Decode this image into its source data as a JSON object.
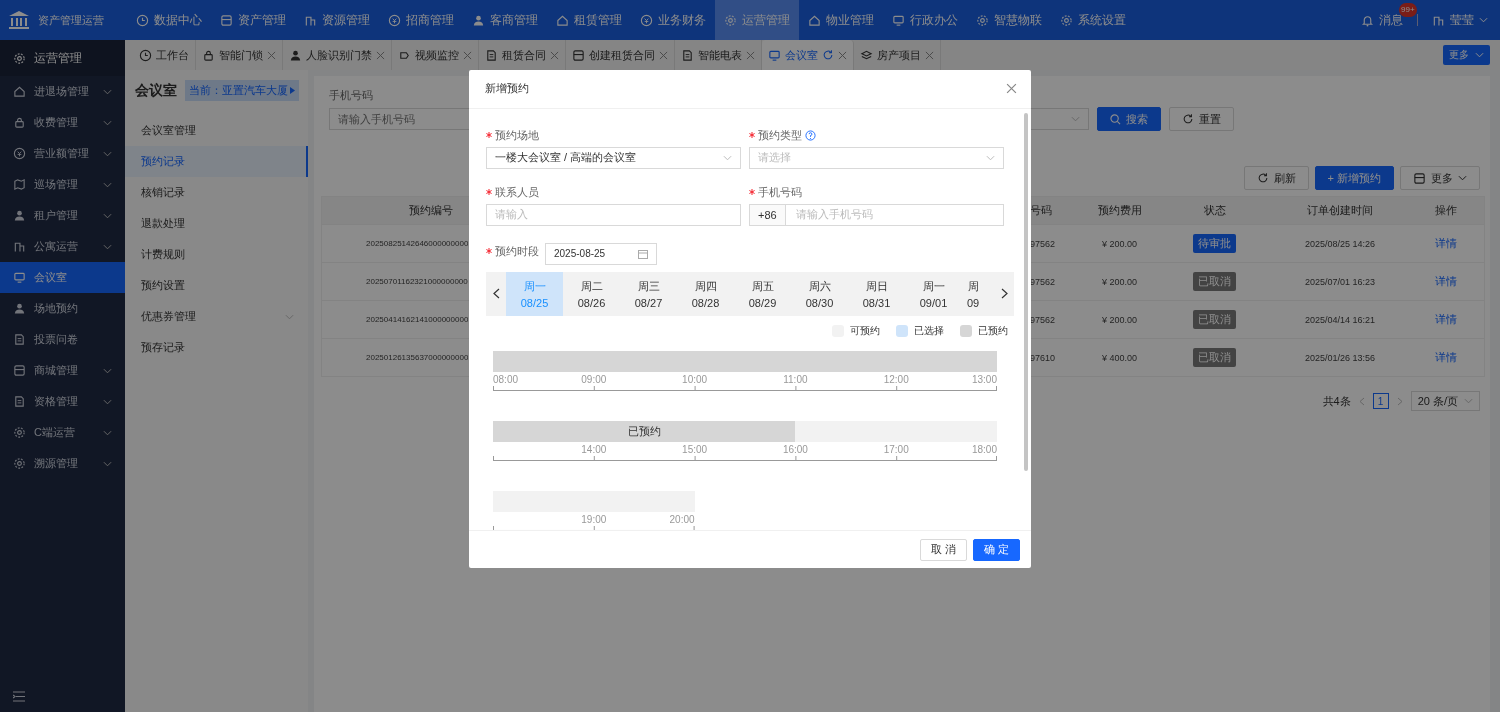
{
  "topbar": {
    "logo_text": "资产管理运营",
    "nav": [
      {
        "label": "数据中心",
        "selected": false
      },
      {
        "label": "资产管理",
        "selected": false
      },
      {
        "label": "资源管理",
        "selected": false
      },
      {
        "label": "招商管理",
        "selected": false
      },
      {
        "label": "客商管理",
        "selected": false
      },
      {
        "label": "租赁管理",
        "selected": false
      },
      {
        "label": "业务财务",
        "selected": false
      },
      {
        "label": "运营管理",
        "selected": true
      },
      {
        "label": "物业管理",
        "selected": false
      },
      {
        "label": "行政办公",
        "selected": false
      },
      {
        "label": "智慧物联",
        "selected": false
      },
      {
        "label": "系统设置",
        "selected": false
      }
    ],
    "messages": {
      "label": "消息",
      "badge": "99+"
    },
    "user": "莹莹"
  },
  "sidebar": {
    "title": "运营管理",
    "items": [
      {
        "label": "进退场管理",
        "expandable": true,
        "selected": false
      },
      {
        "label": "收费管理",
        "expandable": true,
        "selected": false
      },
      {
        "label": "营业额管理",
        "expandable": true,
        "selected": false
      },
      {
        "label": "巡场管理",
        "expandable": true,
        "selected": false
      },
      {
        "label": "租户管理",
        "expandable": true,
        "selected": false
      },
      {
        "label": "公寓运营",
        "expandable": true,
        "selected": false
      },
      {
        "label": "会议室",
        "expandable": false,
        "selected": true
      },
      {
        "label": "场地预约",
        "expandable": false,
        "selected": false
      },
      {
        "label": "投票问卷",
        "expandable": false,
        "selected": false
      },
      {
        "label": "商城管理",
        "expandable": true,
        "selected": false
      },
      {
        "label": "资格管理",
        "expandable": true,
        "selected": false
      },
      {
        "label": "C端运营",
        "expandable": true,
        "selected": false
      },
      {
        "label": "溯源管理",
        "expandable": true,
        "selected": false
      }
    ]
  },
  "tabs": [
    {
      "label": "工作台",
      "closable": false,
      "selected": false
    },
    {
      "label": "智能门锁",
      "closable": true,
      "selected": false
    },
    {
      "label": "人脸识别门禁",
      "closable": true,
      "selected": false
    },
    {
      "label": "视频监控",
      "closable": true,
      "selected": false
    },
    {
      "label": "租赁合同",
      "closable": true,
      "selected": false
    },
    {
      "label": "创建租赁合同",
      "closable": true,
      "selected": false
    },
    {
      "label": "智能电表",
      "closable": true,
      "selected": false
    },
    {
      "label": "会议室",
      "closable": true,
      "selected": true
    },
    {
      "label": "房产项目",
      "closable": true,
      "selected": false
    }
  ],
  "tabs_more": "更多",
  "submenu": {
    "title": "会议室",
    "current": "当前：亚置汽车大厦",
    "items": [
      {
        "label": "会议室管理",
        "expandable": false,
        "selected": false
      },
      {
        "label": "预约记录",
        "expandable": false,
        "selected": true
      },
      {
        "label": "核销记录",
        "expandable": false,
        "selected": false
      },
      {
        "label": "退款处理",
        "expandable": false,
        "selected": false
      },
      {
        "label": "计费规则",
        "expandable": false,
        "selected": false
      },
      {
        "label": "预约设置",
        "expandable": false,
        "selected": false
      },
      {
        "label": "优惠券管理",
        "expandable": true,
        "selected": false
      },
      {
        "label": "预存记录",
        "expandable": false,
        "selected": false
      }
    ]
  },
  "filter": {
    "label": "手机号码",
    "placeholder": "请输入手机号码",
    "search": "搜索",
    "reset": "重置"
  },
  "toolbar": {
    "refresh": "刷新",
    "add": "+ 新增预约",
    "more": "更多"
  },
  "table": {
    "columns": [
      "预约编号",
      "号码",
      "预约费用",
      "状态",
      "订单创建时间",
      "操作"
    ],
    "rows": [
      {
        "id": "20250825142646000000000",
        "phone": "97562",
        "fee": "¥ 200.00",
        "status": "待审批",
        "kind": "pending",
        "created": "2025/08/25 14:26",
        "action": "详情"
      },
      {
        "id": "20250701162321000000000",
        "phone": "97562",
        "fee": "¥ 200.00",
        "status": "已取消",
        "kind": "cancelled",
        "created": "2025/07/01 16:23",
        "action": "详情"
      },
      {
        "id": "20250414162141000000000",
        "phone": "97562",
        "fee": "¥ 200.00",
        "status": "已取消",
        "kind": "cancelled",
        "created": "2025/04/14 16:21",
        "action": "详情"
      },
      {
        "id": "20250126135637000000000",
        "phone": "97610",
        "fee": "¥ 400.00",
        "status": "已取消",
        "kind": "cancelled",
        "created": "2025/01/26 13:56",
        "action": "详情"
      }
    ]
  },
  "pagination": {
    "total": "共4条",
    "pages": [
      {
        "label": "1",
        "selected": true
      }
    ],
    "page_size": "20 条/页"
  },
  "modal": {
    "title": "新增预约",
    "fields": [
      {
        "label": "预约场地",
        "required": true,
        "kind": "select",
        "value": "一楼大会议室 / 高端的会议室",
        "help": false
      },
      {
        "label": "预约类型",
        "required": true,
        "kind": "select",
        "placeholder": "请选择",
        "help": true
      },
      {
        "label": "联系人员",
        "required": true,
        "kind": "text",
        "placeholder": "请输入",
        "help": false
      },
      {
        "label": "手机号码",
        "required": true,
        "kind": "phone",
        "prefix": "+86",
        "placeholder": "请输入手机号码",
        "help": false
      }
    ],
    "period": {
      "label": "预约时段",
      "required": true,
      "date": "2025-08-25"
    },
    "days": [
      {
        "weekday": "周一",
        "date": "08/25",
        "selected": true
      },
      {
        "weekday": "周二",
        "date": "08/26",
        "selected": false
      },
      {
        "weekday": "周三",
        "date": "08/27",
        "selected": false
      },
      {
        "weekday": "周四",
        "date": "08/28",
        "selected": false
      },
      {
        "weekday": "周五",
        "date": "08/29",
        "selected": false
      },
      {
        "weekday": "周六",
        "date": "08/30",
        "selected": false
      },
      {
        "weekday": "周日",
        "date": "08/31",
        "selected": false
      },
      {
        "weekday": "周一",
        "date": "09/01",
        "selected": false
      },
      {
        "weekday": "周",
        "date": "09",
        "selected": false,
        "cut": true
      }
    ],
    "legend": [
      {
        "label": "可预约",
        "kind": "free"
      },
      {
        "label": "已选择",
        "kind": "selected"
      },
      {
        "label": "已预约",
        "kind": "booked"
      }
    ],
    "timeline": [
      {
        "slots": [
          {
            "kind": "booked"
          },
          {
            "kind": "booked"
          },
          {
            "kind": "booked"
          },
          {
            "kind": "booked"
          },
          {
            "kind": "booked"
          }
        ],
        "ticks": [
          "08:00",
          "09:00",
          "10:00",
          "11:00",
          "12:00",
          "13:00"
        ]
      },
      {
        "slots": [
          {
            "kind": "booked"
          },
          {
            "kind": "booked"
          },
          {
            "kind": "booked"
          },
          {
            "kind": "free"
          },
          {
            "kind": "free"
          }
        ],
        "label": "已预约",
        "ticks": [
          "14:00",
          "15:00",
          "16:00",
          "17:00",
          "18:00"
        ]
      },
      {
        "slots": [
          {
            "kind": "free"
          },
          {
            "kind": "free"
          }
        ],
        "ticks": [
          "19:00",
          "20:00"
        ]
      }
    ],
    "cancel": "取 消",
    "ok": "确 定"
  }
}
